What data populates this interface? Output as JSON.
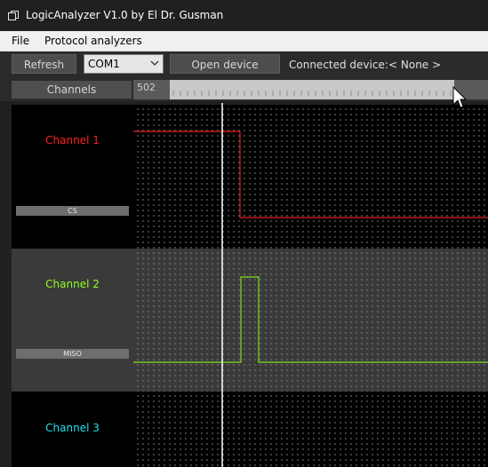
{
  "window": {
    "title": "LogicAnalyzer V1.0 by El Dr. Gusman"
  },
  "menu": {
    "items": [
      "File",
      "Protocol analyzers"
    ]
  },
  "toolbar": {
    "refresh_label": "Refresh",
    "port_value": "COM1",
    "open_label": "Open device",
    "connected_label": "Connected device:",
    "connected_value": "< None >"
  },
  "timeline": {
    "channels_header": "Channels",
    "offset": "502"
  },
  "channels": [
    {
      "name": "Channel 1",
      "tag": "CS",
      "color": "#ff2020"
    },
    {
      "name": "Channel 2",
      "tag": "MISO",
      "color": "#90ff20"
    },
    {
      "name": "Channel 3",
      "tag": "",
      "color": "#20e0f0"
    }
  ],
  "colors": {
    "window_bg": "#202020",
    "channel1_trace": "#e02020",
    "channel2_trace": "#80e020",
    "marker": "#ffffff"
  }
}
